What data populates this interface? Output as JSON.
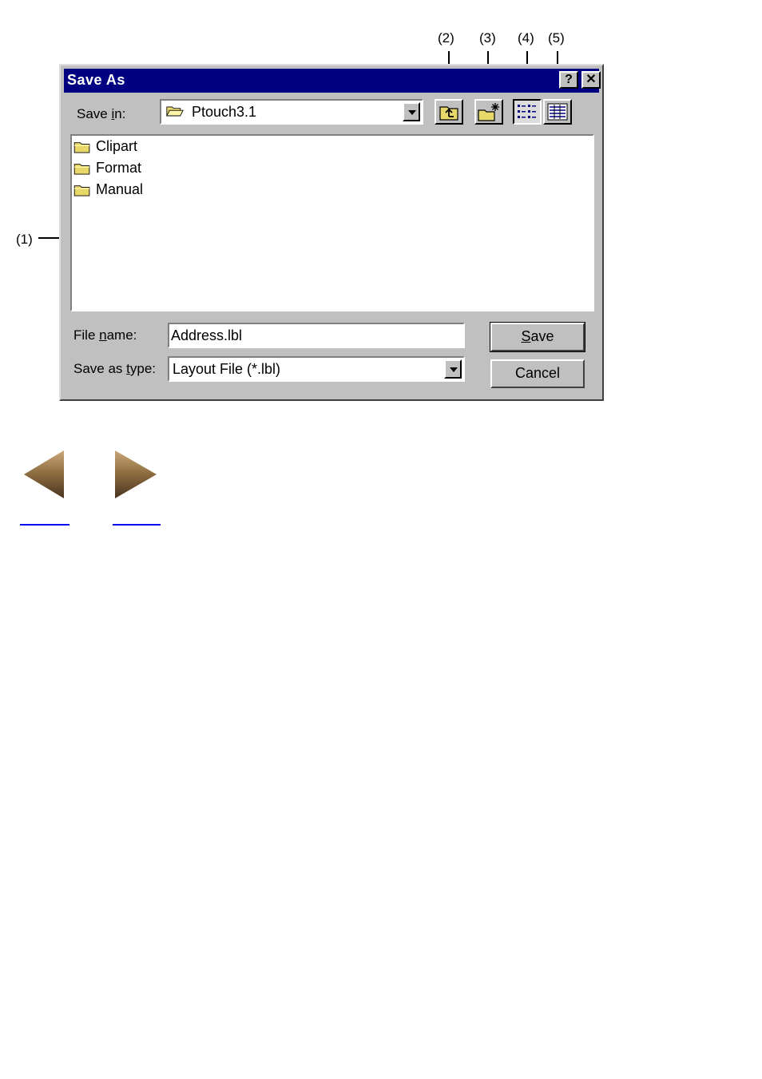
{
  "callouts": {
    "c1": "(1)",
    "c2": "(2)",
    "c3": "(3)",
    "c4": "(4)",
    "c5": "(5)"
  },
  "dialog": {
    "title": "Save As",
    "help_button": "?",
    "close_button": "✕",
    "save_in": {
      "label_pre": "Save ",
      "label_ul": "i",
      "label_post": "n:",
      "value": "Ptouch3.1"
    },
    "files": [
      {
        "name": "Clipart"
      },
      {
        "name": "Format"
      },
      {
        "name": "Manual"
      }
    ],
    "file_name": {
      "label_pre": "File ",
      "label_ul": "n",
      "label_post": "ame:",
      "value": "Address.lbl"
    },
    "save_as_type": {
      "label_pre": "Save as ",
      "label_ul": "t",
      "label_post": "ype:",
      "value": "Layout File (*.lbl)"
    },
    "save_button": {
      "ul": "S",
      "rest": "ave"
    },
    "cancel_button": "Cancel"
  },
  "colors": {
    "titlebar": "#000080",
    "face": "#c0c0c0",
    "arrow": "#8b6a3e",
    "link": "#0000ee"
  },
  "icons": [
    "up-one-level-icon",
    "create-new-folder-icon",
    "list-view-icon",
    "details-view-icon",
    "folder-icon",
    "back-arrow-icon",
    "forward-arrow-icon"
  ]
}
